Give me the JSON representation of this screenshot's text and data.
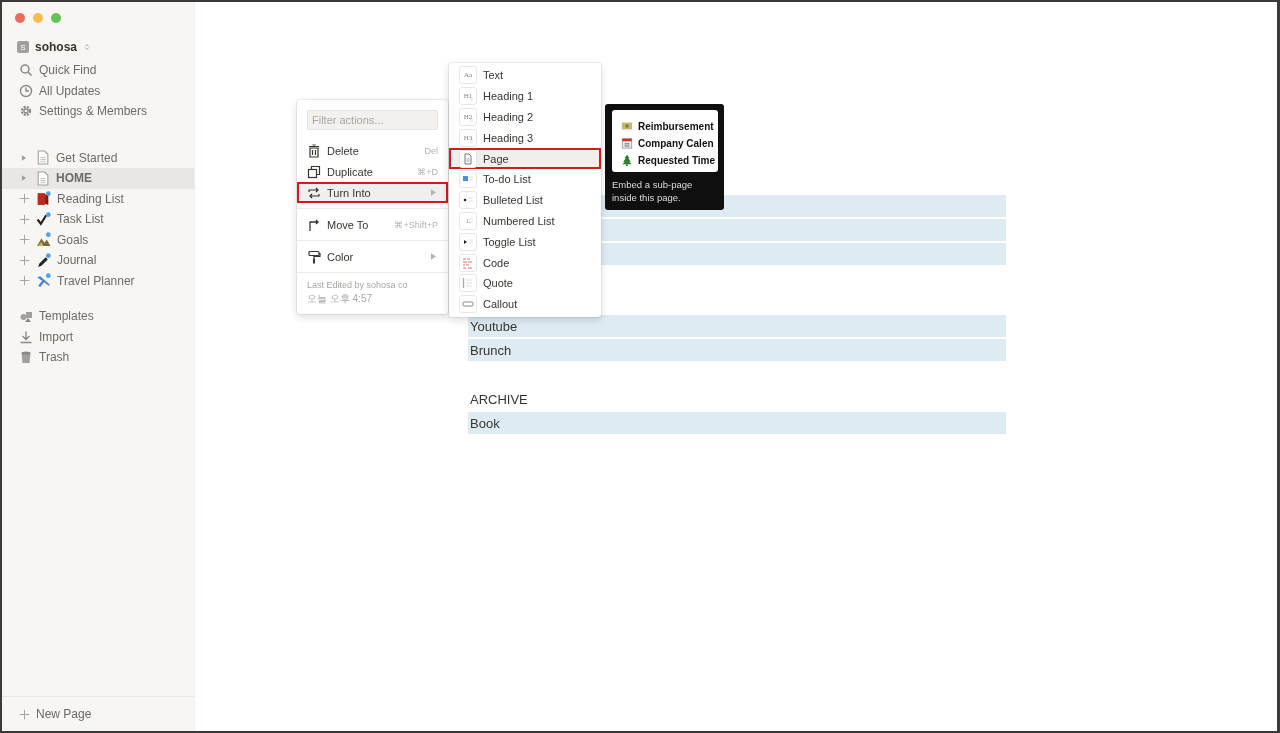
{
  "sidebar": {
    "workspace": {
      "initial": "S",
      "name": "sohosa"
    },
    "nav": [
      {
        "label": "Quick Find",
        "kind": "search"
      },
      {
        "label": "All Updates",
        "kind": "updates"
      },
      {
        "label": "Settings & Members",
        "kind": "settings"
      }
    ],
    "pages": [
      {
        "label": "Get Started",
        "kind": "doc",
        "selected": false
      },
      {
        "label": "HOME",
        "kind": "doc",
        "selected": true
      },
      {
        "label": "Reading List",
        "kind": "book",
        "selected": false
      },
      {
        "label": "Task List",
        "kind": "check",
        "selected": false
      },
      {
        "label": "Goals",
        "kind": "mountain",
        "selected": false
      },
      {
        "label": "Journal",
        "kind": "pen",
        "selected": false
      },
      {
        "label": "Travel Planner",
        "kind": "plane",
        "selected": false
      }
    ],
    "tools": [
      {
        "label": "Templates",
        "kind": "templates"
      },
      {
        "label": "Import",
        "kind": "import"
      },
      {
        "label": "Trash",
        "kind": "trash"
      }
    ],
    "new_page": "New Page"
  },
  "page": {
    "blocks": [
      {
        "kind": "row"
      },
      {
        "kind": "row"
      },
      {
        "kind": "row"
      },
      {
        "kind": "gap"
      },
      {
        "kind": "row",
        "text": "Youtube"
      },
      {
        "kind": "row",
        "text": "Brunch"
      },
      {
        "kind": "gap"
      },
      {
        "kind": "heading",
        "text": "ARCHIVE"
      },
      {
        "kind": "row",
        "text": "Book"
      }
    ]
  },
  "action_menu": {
    "filter": {
      "placeholder": "Filter actions..."
    },
    "groups": [
      [
        {
          "label": "Delete",
          "kind": "delete",
          "shortcut": "Del",
          "submenu": false,
          "selected": false
        },
        {
          "label": "Duplicate",
          "kind": "duplicate",
          "shortcut": "⌘+D",
          "submenu": false,
          "selected": false
        },
        {
          "label": "Turn Into",
          "kind": "turn",
          "submenu": true,
          "selected": true
        }
      ],
      [
        {
          "label": "Move To",
          "kind": "move",
          "shortcut": "⌘+Shift+P",
          "submenu": false,
          "selected": false
        }
      ],
      [
        {
          "label": "Color",
          "kind": "color",
          "submenu": true,
          "selected": false
        }
      ]
    ],
    "footer": [
      "Last Edited by sohosa co",
      "오늘 오후 4:57"
    ]
  },
  "turn_into_menu": {
    "items": [
      {
        "label": "Text",
        "kind": "text",
        "glyph": "Aa",
        "selected": false
      },
      {
        "label": "Heading 1",
        "kind": "heading",
        "glyph": "H1",
        "selected": false
      },
      {
        "label": "Heading 2",
        "kind": "heading",
        "glyph": "H2",
        "selected": false
      },
      {
        "label": "Heading 3",
        "kind": "heading",
        "glyph": "H3",
        "selected": false
      },
      {
        "label": "Page",
        "kind": "page",
        "selected": true
      },
      {
        "label": "To-do List",
        "kind": "todo",
        "selected": false
      },
      {
        "label": "Bulleted List",
        "kind": "bullet",
        "selected": false
      },
      {
        "label": "Numbered List",
        "kind": "number",
        "glyph": "1.",
        "selected": false
      },
      {
        "label": "Toggle List",
        "kind": "toggle",
        "selected": false
      },
      {
        "label": "Code",
        "kind": "code",
        "selected": false
      },
      {
        "label": "Quote",
        "kind": "quote",
        "selected": false
      },
      {
        "label": "Callout",
        "kind": "callout",
        "selected": false
      }
    ]
  },
  "tooltip": {
    "preview": [
      {
        "label": "Reimbursement",
        "kind": "money"
      },
      {
        "label": "Company Calen",
        "kind": "calendar"
      },
      {
        "label": "Requested Time",
        "kind": "tree"
      }
    ],
    "caption": "Embed a sub-page inside this page."
  }
}
